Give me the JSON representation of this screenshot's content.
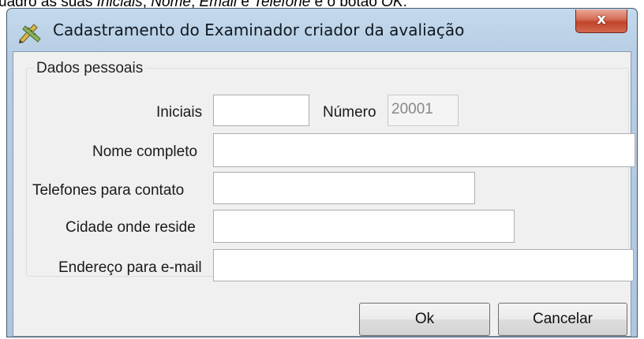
{
  "caption": {
    "prefix": "uadro as suas ",
    "iniciais": "Iniciais",
    "sep1": ", ",
    "nome": "Nome",
    "sep2": ", ",
    "email": "Email",
    "sep3": " e ",
    "telefone": "Telefone",
    "suffix": " e o botão ",
    "ok": "OK",
    "end": "."
  },
  "window": {
    "title": "Cadastramento do Examinador criador da avaliação",
    "close_label": "x",
    "icon": "pencil-ruler-icon"
  },
  "group": {
    "legend": "Dados pessoais",
    "fields": {
      "iniciais": {
        "label": "Iniciais",
        "value": ""
      },
      "numero": {
        "label": "Número",
        "value": "20001"
      },
      "nome": {
        "label": "Nome completo",
        "value": ""
      },
      "telefones": {
        "label": "Telefones para contato",
        "value": ""
      },
      "cidade": {
        "label": "Cidade onde reside",
        "value": ""
      },
      "email": {
        "label": "Endereço para e-mail",
        "value": ""
      }
    }
  },
  "buttons": {
    "ok": "Ok",
    "cancel": "Cancelar"
  }
}
